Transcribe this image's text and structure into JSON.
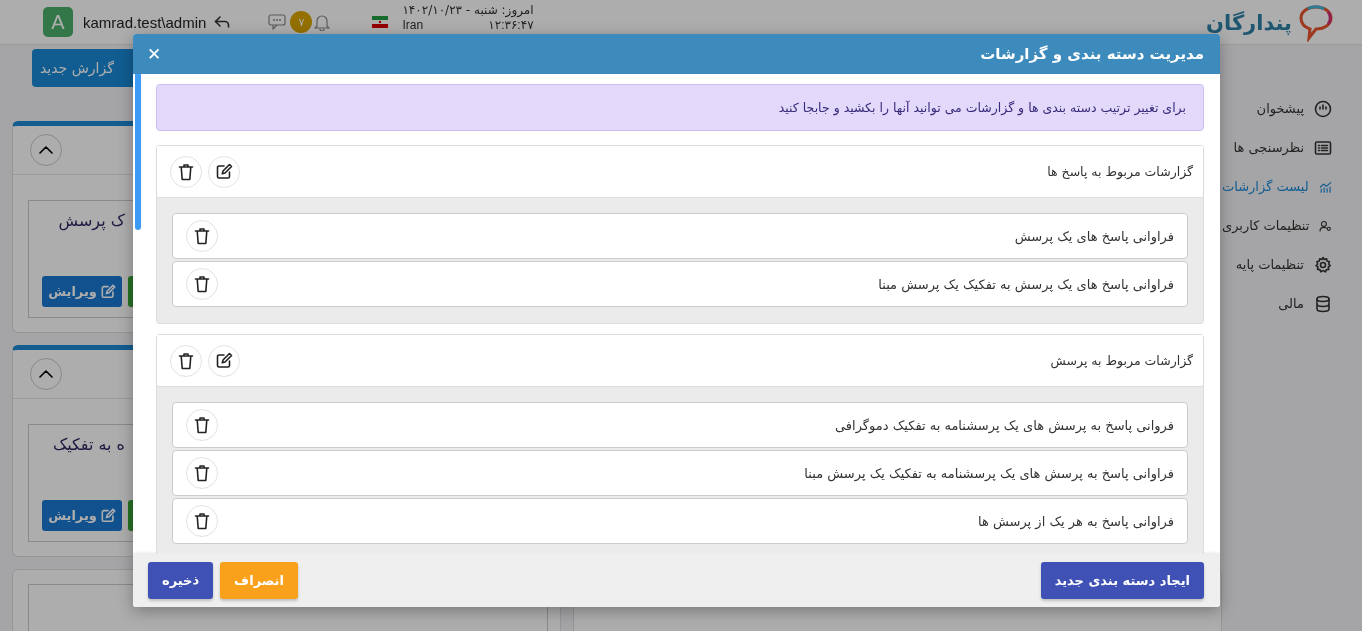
{
  "header": {
    "avatar_letter": "A",
    "user_name": "kamrad.test\\admin",
    "notifications_count": "۷",
    "date_line": "امروز: شنبه - ۱۴۰۲/۱۰/۲۳",
    "country": "Iran",
    "time": "۱۲:۳۶:۴۷",
    "logo_text": "پندارگان"
  },
  "toolbar": {
    "new_report_button": "گزارش جدید"
  },
  "sidebar": {
    "items": [
      {
        "label": "پیشخوان",
        "selected": false
      },
      {
        "label": "نظرسنجی ها",
        "selected": false
      },
      {
        "label": "لیست گزارشات",
        "selected": true
      },
      {
        "label": "تنظیمات کاربری",
        "selected": false
      },
      {
        "label": "تنظیمات پایه",
        "selected": false
      },
      {
        "label": "مالی",
        "selected": false
      }
    ]
  },
  "background_cards": [
    {
      "title": "ک پرسش",
      "edit_button": "ویرایش"
    },
    {
      "title": "ه به تفکیک",
      "edit_button": "ویرایش"
    }
  ],
  "modal": {
    "title": "مدیریت دسته بندی و گزارشات",
    "close": "✕",
    "notice": "برای تغییر ترتیب دسته بندی ها و گزارشات می توانید آنها را بکشید و جابجا کنید",
    "categories": [
      {
        "title": "گزارشات مربوط به پاسخ ها",
        "reports": [
          "فراوانی پاسخ های یک پرسش",
          "فراوانی پاسخ های یک پرسش به تفکیک یک پرسش مبنا"
        ]
      },
      {
        "title": "گزارشات مربوط به پرسش",
        "reports": [
          "فروانی پاسخ به پرسش های یک پرسشنامه به تفکیک دموگرافی",
          "فراوانی پاسخ به پرسش های یک پرسشنامه به تفکیک یک پرسش مبنا",
          "فراوانی پاسخ به هر یک از پرسش ها"
        ]
      }
    ],
    "buttons": {
      "create": "ایجاد دسته بندی جدید",
      "cancel": "انصراف",
      "save": "ذخیره"
    }
  }
}
